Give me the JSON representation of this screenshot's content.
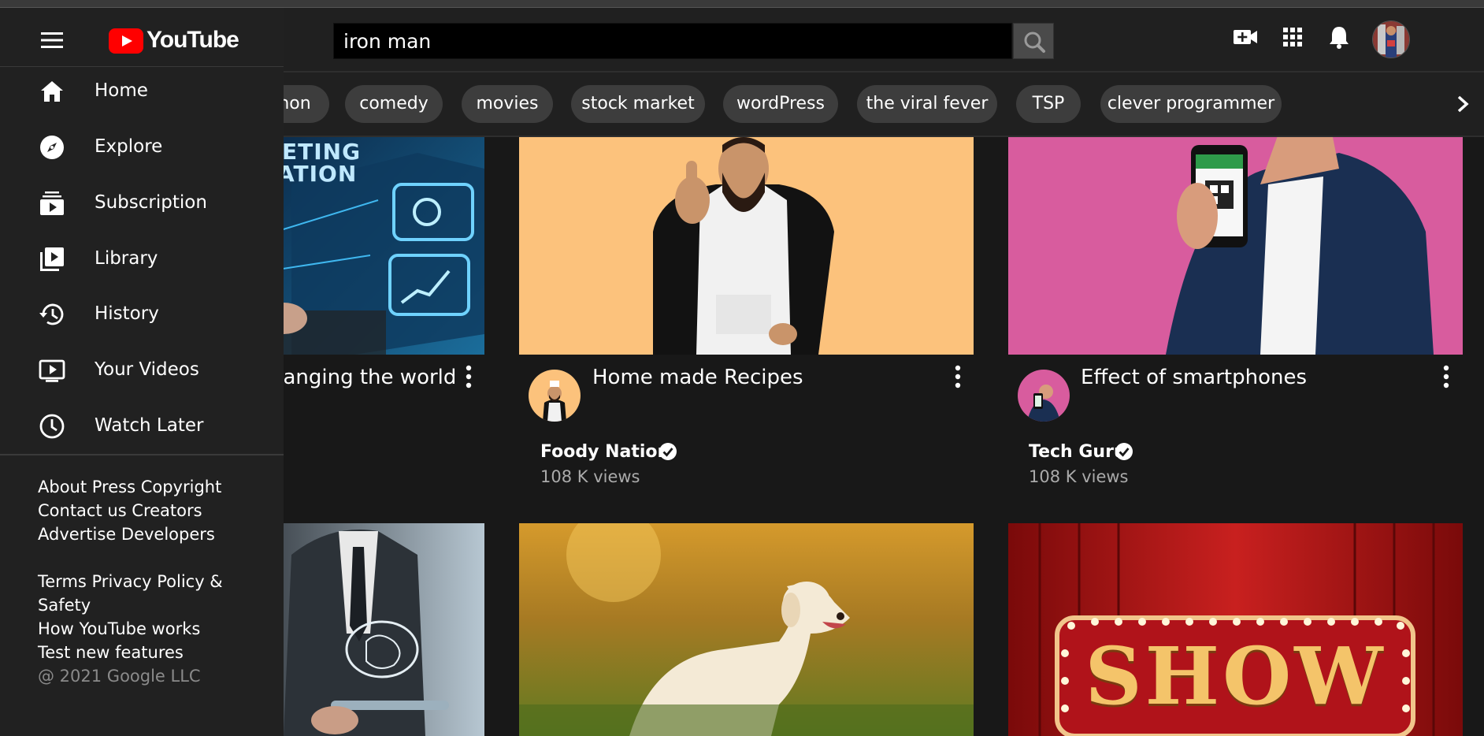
{
  "search": {
    "query": "iron man"
  },
  "brand": {
    "logo_text": "YouTube",
    "accent": "#ff0000"
  },
  "sidebar": {
    "items": [
      {
        "label": "Home",
        "icon": "home-icon"
      },
      {
        "label": "Explore",
        "icon": "compass-icon"
      },
      {
        "label": "Subscription",
        "icon": "subscriptions-icon"
      },
      {
        "label": "Library",
        "icon": "library-icon"
      },
      {
        "label": "History",
        "icon": "history-icon"
      },
      {
        "label": "Your Videos",
        "icon": "your-videos-icon"
      },
      {
        "label": "Watch Later",
        "icon": "clock-icon"
      }
    ],
    "footer": [
      "About Press Copyright",
      "Contact us Creators",
      "Advertise Developers",
      "Terms Privacy Policy &",
      "Safety",
      "How YouTube works",
      "Test new features",
      "@ 2021 Google LLC"
    ]
  },
  "chips": [
    "hon",
    "comedy",
    "movies",
    "stock market",
    "wordPress",
    "the viral fever",
    "TSP",
    "clever programmer"
  ],
  "videos": [
    {
      "title": "hanging the world"
    },
    {
      "title": "Home made Recipes",
      "channel": "Foody Nation",
      "views": "108 K views"
    },
    {
      "title": "Effect of smartphones",
      "channel": "Tech Guru",
      "views": "108 K views"
    }
  ],
  "thumb_text": {
    "show": "SHOW",
    "marketing_1": "ETING",
    "marketing_2": "ATION"
  }
}
